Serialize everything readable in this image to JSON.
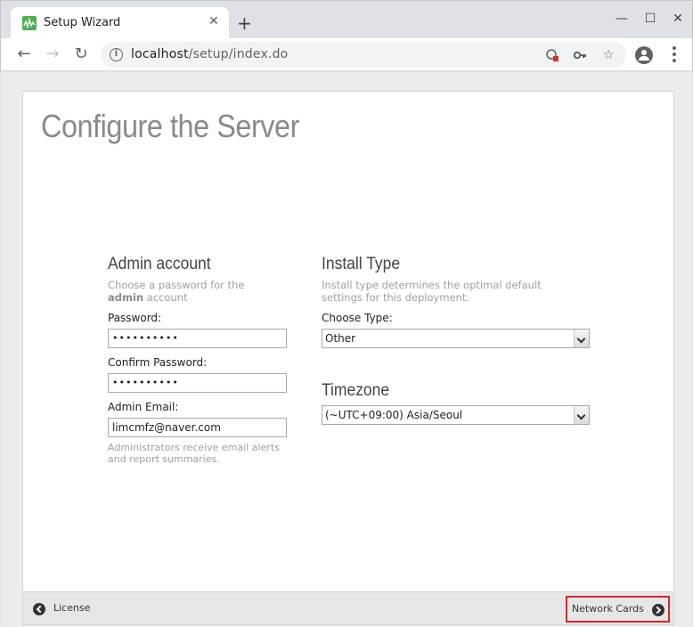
{
  "browser": {
    "tab_title": "Setup Wizard",
    "tab_close": "✕",
    "new_tab": "+",
    "window_controls": {
      "minimize": "—",
      "maximize": "☐",
      "close": "✕"
    },
    "nav": {
      "back": "←",
      "forward": "→",
      "reload": "↻"
    },
    "url_host": "localhost",
    "url_path": "/setup/index.do",
    "icons": [
      "info-icon",
      "blocked-content-icon",
      "key-icon",
      "star-icon",
      "profile-icon",
      "menu-icon"
    ]
  },
  "page": {
    "title": "Configure the Server",
    "admin": {
      "heading": "Admin account",
      "hint_prefix": "Choose a password for the",
      "hint_bold": "admin",
      "hint_suffix": "account",
      "password_label": "Password:",
      "password_value": "••••••••••",
      "confirm_label": "Confirm Password:",
      "confirm_value": "••••••••••",
      "email_label": "Admin Email:",
      "email_value": "limcmfz@naver.com",
      "email_hint_line1": "Administrators receive email alerts",
      "email_hint_line2": "and report summaries."
    },
    "install": {
      "heading": "Install Type",
      "hint_line1": "Install type determines the optimal default",
      "hint_line2": "settings for this deployment.",
      "type_label": "Choose Type:",
      "type_value": "Other"
    },
    "timezone": {
      "heading": "Timezone",
      "value": "(~UTC+09:00) Asia/Seoul"
    },
    "footer": {
      "prev_label": "License",
      "next_label": "Network Cards"
    }
  },
  "colors": {
    "highlight_border": "#d9252a",
    "title_gray": "#8a8a8a"
  }
}
